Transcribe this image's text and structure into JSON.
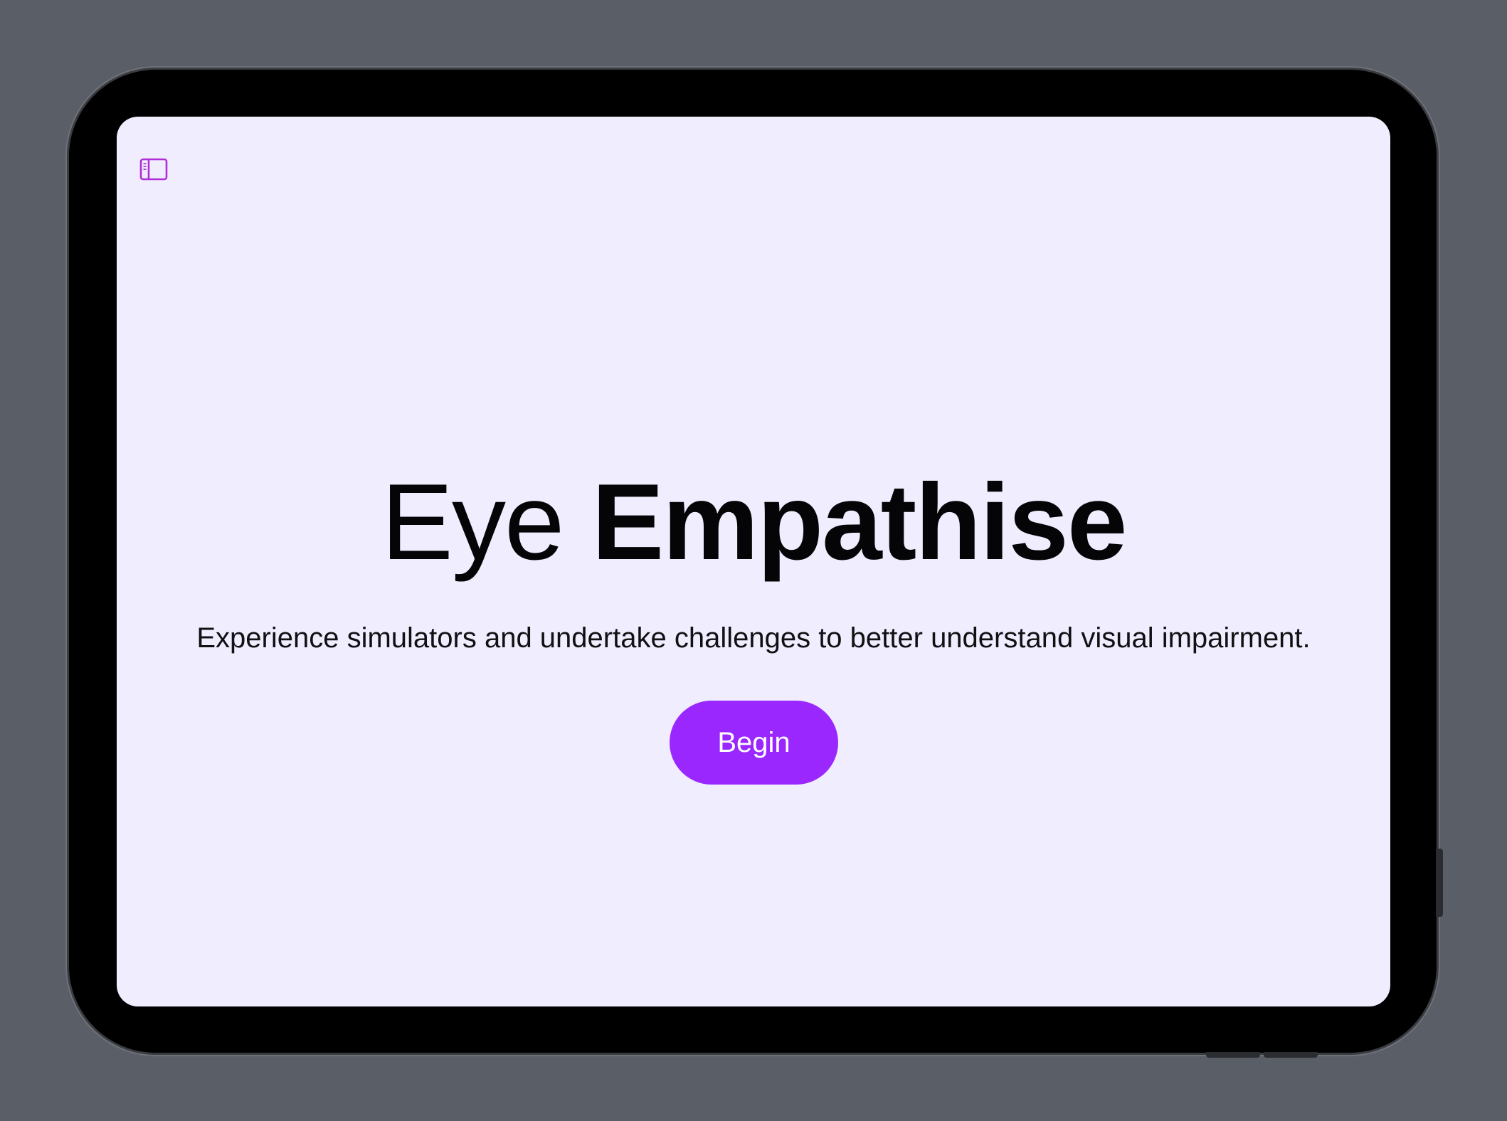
{
  "app": {
    "title_part1": "Eye",
    "title_part2": "Empathise",
    "subtitle": "Experience simulators and undertake challenges to better understand visual impairment.",
    "begin_label": "Begin"
  },
  "icons": {
    "sidebar_toggle": "sidebar-left-icon"
  },
  "colors": {
    "accent": "#9b27ff",
    "screen_background": "#efedfe",
    "icon_tint": "#b02fd6"
  }
}
